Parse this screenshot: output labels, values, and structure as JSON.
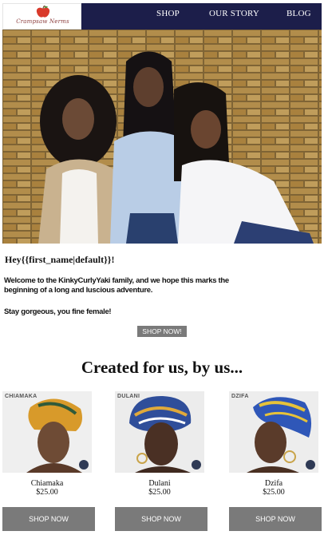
{
  "brand": {
    "name": "Crampsaw Nerms",
    "apple_color": "#d93a2b",
    "leaf_color": "#3f8a2e"
  },
  "nav": {
    "shop": "SHOP",
    "our_story": "OUR STORY",
    "blog": "BLOG",
    "bg_color": "#1c1e4a"
  },
  "greeting": "Hey{{first_name|default}}!",
  "welcome_text": "Welcome to the KinkyCurlyYaki family, and we hope this marks the beginning of a long and luscious adventure.",
  "closing_text": "Stay gorgeous, you fine female!",
  "shop_now_top": "SHOP NOW!",
  "section_title": "Created for us, by us...",
  "products": [
    {
      "label": "CHIAMAKA",
      "name": "Chiamaka",
      "price": "$25.00",
      "button": "SHOP NOW"
    },
    {
      "label": "DULANI",
      "name": "Dulani",
      "price": "$25.00",
      "button": "SHOP NOW"
    },
    {
      "label": "DZIFA",
      "name": "Dzifa",
      "price": "$25.00",
      "button": "SHOP NOW"
    }
  ],
  "button_color": "#7a7a7a"
}
